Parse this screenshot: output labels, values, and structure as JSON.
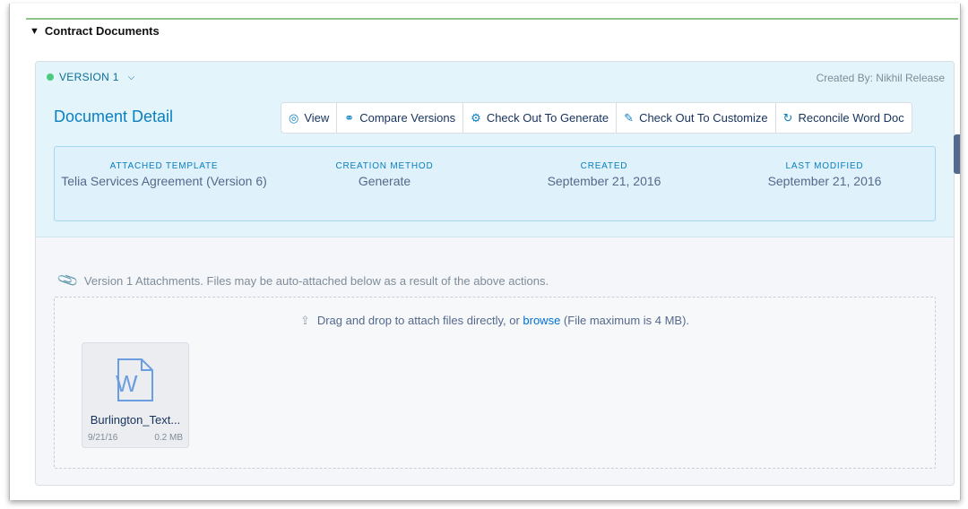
{
  "section": {
    "title": "Contract Documents",
    "toggle_glyph": "▼"
  },
  "version": {
    "label": "VERSION 1",
    "chevron": "⌵",
    "created_by": "Created By: Nikhil Release"
  },
  "detail": {
    "title": "Document Detail",
    "actions": [
      {
        "label": "View",
        "icon": "eye-icon",
        "glyph": "◎"
      },
      {
        "label": "Compare Versions",
        "icon": "compare-icon",
        "glyph": "⚭"
      },
      {
        "label": "Check Out To Generate",
        "icon": "gear-generate-icon",
        "glyph": "⚙"
      },
      {
        "label": "Check Out To Customize",
        "icon": "edit-icon",
        "glyph": "✎"
      },
      {
        "label": "Reconcile Word Doc",
        "icon": "reconcile-icon",
        "glyph": "↻"
      }
    ],
    "fields": [
      {
        "label": "ATTACHED TEMPLATE",
        "value": "Telia Services Agreement (Version 6)"
      },
      {
        "label": "CREATION METHOD",
        "value": "Generate"
      },
      {
        "label": "CREATED",
        "value": "September 21, 2016"
      },
      {
        "label": "LAST MODIFIED",
        "value": "September 21, 2016"
      }
    ]
  },
  "attachments": {
    "note": "Version 1 Attachments. Files may be auto-attached below as a result of the above actions.",
    "drop_prefix": "Drag and drop to attach files directly, or ",
    "browse": "browse",
    "drop_suffix": " (File maximum is 4 MB).",
    "files": [
      {
        "name": "Burlington_Text...",
        "date": "9/21/16",
        "size": "0.2 MB",
        "icon": "word-file-icon",
        "icon_letter": "W"
      }
    ]
  },
  "colors": {
    "accent": "#0b7fbf",
    "header_bg": "#e3f4fb",
    "rule": "#8ec38a",
    "status_dot": "#4bca81"
  }
}
